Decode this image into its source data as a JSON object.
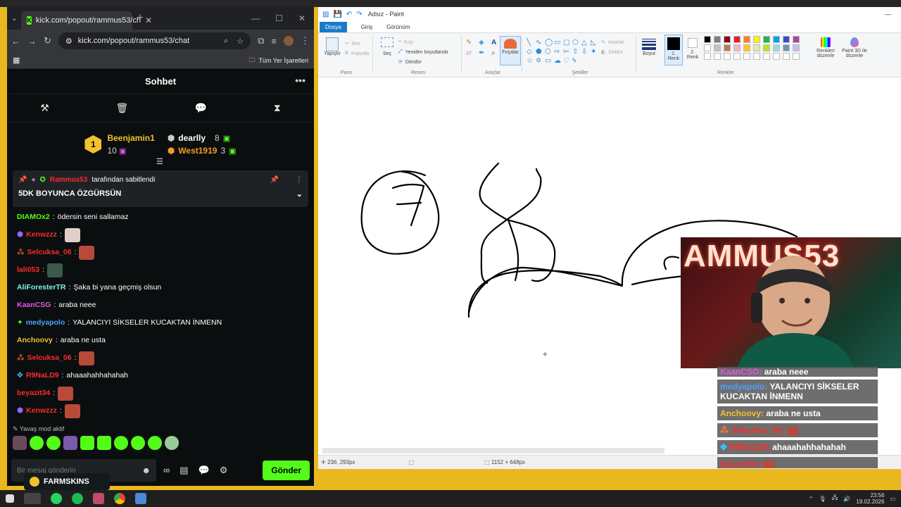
{
  "chrome": {
    "tab_title": "kick.com/popout/rammus53/ch",
    "url": "kick.com/popout/rammus53/chat",
    "bookmarks_all": "Tüm Yer İşaretleri"
  },
  "chat": {
    "header": "Sohbet",
    "leaderboard": {
      "first_name": "Beenjamin1",
      "first_value": "10",
      "second_name": "dearlly",
      "second_value": "8",
      "third_name": "West1919",
      "third_value": "3",
      "medal": "1"
    },
    "pinned": {
      "author": "Rammus53",
      "suffix": "tarafından sabitlendi",
      "message": "5DK BOYUNCA ÖZGÜRSÜN"
    },
    "messages": [
      {
        "user": "DIAMOx2",
        "color": "#53fc18",
        "text": "ödersin seni sallamaz"
      },
      {
        "user": "Kenwzzz",
        "color": "#ff2a2a",
        "text": ""
      },
      {
        "user": "Selcuksa_06",
        "color": "#ff2a2a",
        "text": ""
      },
      {
        "user": "lali053",
        "color": "#ff2a2a",
        "text": ""
      },
      {
        "user": "AliForesterTR",
        "color": "#7ff0e5",
        "text": "Şaka bi yana geçmiş olsun"
      },
      {
        "user": "KaanCSG",
        "color": "#e255e6",
        "text": "araba neee"
      },
      {
        "user": "medyapolo",
        "color": "#4aa3ff",
        "text": "YALANCIYI SİKSELER KUCAKTAN İNMENN"
      },
      {
        "user": "Anchoovy",
        "color": "#f2c12e",
        "text": "araba ne usta"
      },
      {
        "user": "Selcuksa_06",
        "color": "#ff2a2a",
        "text": ""
      },
      {
        "user": "R9NaLD9",
        "color": "#ff2a2a",
        "text": "ahaaahahhahahah"
      },
      {
        "user": "beyazit34",
        "color": "#ff2a2a",
        "text": ""
      },
      {
        "user": "Kenwzzz",
        "color": "#ff2a2a",
        "text": ""
      }
    ],
    "slow_mode": "Yavaş mod aktif",
    "input_placeholder": "Bir mesaj gönderin",
    "send_label": "Gönder",
    "farmskins": "FARMSKINS"
  },
  "paint": {
    "title": "Adsız - Paint",
    "tabs": [
      "Dosya",
      "Giriş",
      "Görünüm"
    ],
    "groups": {
      "pano": "Pano",
      "resim": "Resim",
      "araclar": "Araçlar",
      "sekiller": "Şekiller",
      "renkler": "Renkler"
    },
    "buttons": {
      "yapistir": "Yapıştır",
      "kes": "Kes",
      "kopyala": "Kopyala",
      "sec": "Seç",
      "kirp": "Kırp",
      "yeniden_boyutlandir": "Yeniden boyutlandır",
      "dondur": "Döndür",
      "fircalar": "Fırçalar",
      "anahat": "Anahat",
      "doldur": "Doldur",
      "boyut": "Boyut",
      "renk1": "1. Renk",
      "renk2": "2. Renk",
      "renkleri_duzenle": "Renkleri düzenle",
      "paint3d": "Paint 3D ile düzenle"
    },
    "palette": [
      "#000000",
      "#7f7f7f",
      "#880015",
      "#ed1c24",
      "#ff7f27",
      "#fff200",
      "#22b14c",
      "#00a2e8",
      "#3f48cc",
      "#a349a4",
      "#ffffff",
      "#c3c3c3",
      "#b97a57",
      "#ffaec9",
      "#ffc90e",
      "#efe4b0",
      "#b5e61d",
      "#99d9ea",
      "#7092be",
      "#c8bfe7"
    ],
    "status_cursor": "236, 293px",
    "status_size": "1152 × 648px"
  },
  "overlay": {
    "title": "AMMUS53",
    "stream_chat": [
      {
        "user": "KaanCSG:",
        "color": "#e255e6",
        "text": "araba neee"
      },
      {
        "user": "medyapolo:",
        "color": "#4aa3ff",
        "text": "YALANCIYI SİKSELER KUCAKTAN İNMENN"
      },
      {
        "user": "Anchoovy:",
        "color": "#f2c12e",
        "text": "araba ne usta"
      },
      {
        "user": "Selcuksa_06:",
        "color": "#ff2a2a",
        "text": ""
      },
      {
        "user": "R9NaLD9:",
        "color": "#ff2a2a",
        "text": "ahaaahahhahahah"
      },
      {
        "user": "beyazit34:",
        "color": "#ff2a2a",
        "text": ""
      }
    ]
  },
  "taskbar": {
    "time": "23:56",
    "date": "19.02.2026"
  }
}
